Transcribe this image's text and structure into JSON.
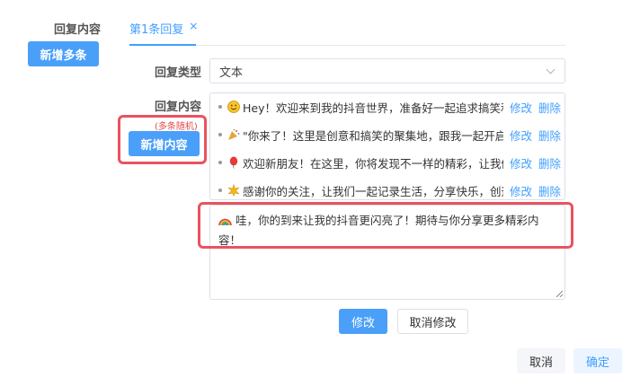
{
  "left_panel": {
    "label": "回复内容",
    "add_multi_label": "新增多条"
  },
  "tab": {
    "label": "第1条回复",
    "close": "×"
  },
  "reply_type": {
    "label": "回复类型",
    "value": "文本"
  },
  "reply_content": {
    "label": "回复内容",
    "note": "(多条随机)",
    "add_content_label": "新增内容",
    "items": [
      {
        "icon": "smile-emoji",
        "text": "Hey！欢迎来到我的抖音世界，准备好一起追求搞笑和快乐吧！",
        "edit": "修改",
        "delete": "删除"
      },
      {
        "icon": "party-popper-emoji",
        "text": "\"你来了！这里是创意和搞笑的聚集地，跟我一起开启欢乐之旅吧！",
        "edit": "修改",
        "delete": "删除"
      },
      {
        "icon": "balloon-emoji",
        "text": "欢迎新朋友！在这里，你将发现不一样的精彩，让我们一起分享吧！",
        "edit": "修改",
        "delete": "删除"
      },
      {
        "icon": "sparkle-emoji",
        "text": "感谢你的关注，让我们一起记录生活，分享快乐，创造美好回忆！",
        "edit": "修改",
        "delete": "删除"
      }
    ],
    "editing_text": "哇，你的到来让我的抖音更闪亮了！期待与你分享更多精彩内容！",
    "editing_icon": "rainbow-emoji"
  },
  "edit_actions": {
    "confirm_edit": "修改",
    "cancel_edit": "取消修改"
  },
  "footer": {
    "cancel": "取消",
    "ok": "确定"
  },
  "colors": {
    "primary": "#4a9ff9",
    "highlight": "#e8535f",
    "note_red": "#e04a4a"
  }
}
